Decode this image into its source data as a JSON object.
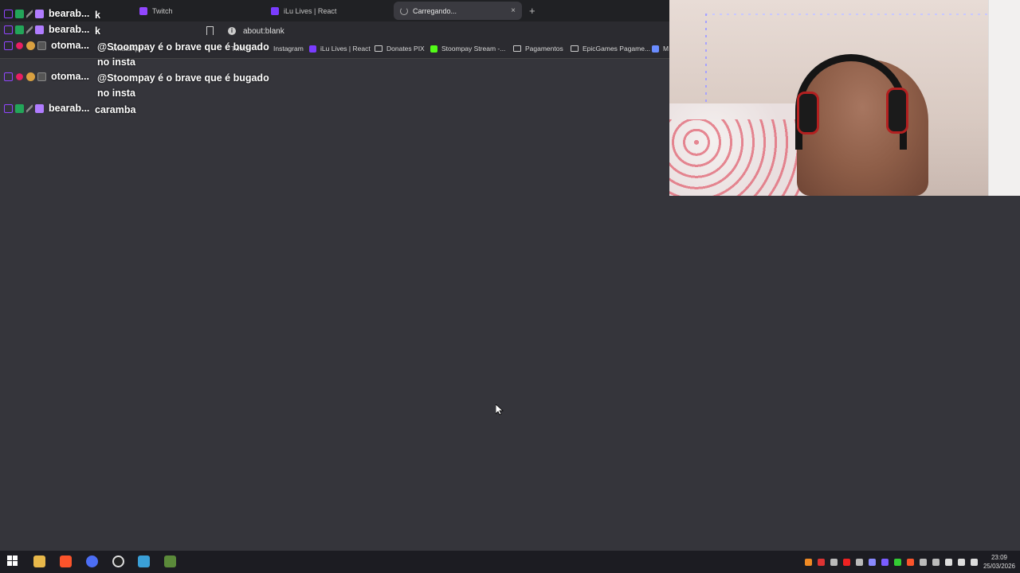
{
  "browser": {
    "tabs": [
      {
        "label": "Twitch",
        "color": "#9146ff"
      },
      {
        "label": "iLu Lives | React",
        "color": "#7a3cff"
      },
      {
        "label": "Carregando...",
        "color": "#aaaaaa",
        "active": true
      }
    ],
    "new_tab": "+",
    "close_tab": "×",
    "address": "about:blank",
    "bookmarks": [
      {
        "label": "WhatsApp",
        "color": "#25d366"
      },
      {
        "label": "Twitch",
        "color": "#9146ff"
      },
      {
        "label": "Instagram",
        "color": "#e1306c"
      },
      {
        "label": "iLu Lives | React",
        "color": "#7a3cff"
      },
      {
        "label": "Donates PIX",
        "folder": true
      },
      {
        "label": "Stoompay Stream -...",
        "color": "#53fc18"
      },
      {
        "label": "Pagamentos",
        "folder": true
      },
      {
        "label": "EpicGames Pagame...",
        "folder": true
      },
      {
        "label": "M",
        "color": "#6a8cff"
      }
    ]
  },
  "chat": {
    "messages": [
      {
        "user": "bearab...",
        "text": "k",
        "user_color": "#ffffff"
      },
      {
        "user": "bearab...",
        "text": "k",
        "user_color": "#ffffff"
      },
      {
        "user": "otoma...",
        "text": "@Stoompay é o brave que é bugado no insta",
        "user_color": "#ffffff"
      },
      {
        "user": "otoma...",
        "text": "@Stoompay é o brave que é bugado no insta",
        "user_color": "#ffffff"
      },
      {
        "user": "bearab...",
        "text": "caramba",
        "user_color": "#ffffff"
      }
    ]
  },
  "taskbar": {
    "time": "23:09",
    "date": "25/03/2026",
    "apps": [
      "windows-start",
      "file-explorer",
      "brave",
      "chrome",
      "obs",
      "app-5",
      "minecraft"
    ]
  },
  "colors": {
    "background": "#35353b",
    "tabbar": "#202124",
    "taskbar": "#1c1c22"
  }
}
